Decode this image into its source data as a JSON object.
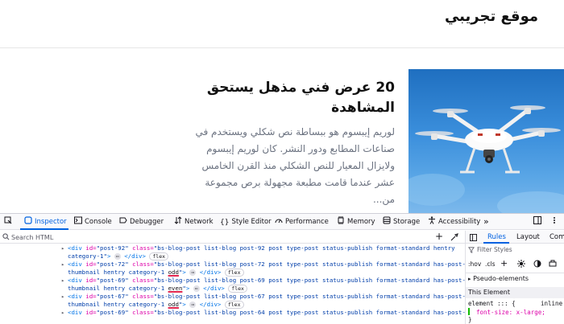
{
  "site": {
    "title": "موقع تجريبي",
    "post": {
      "title_line1": "20 عرض فني مذهل يستحق",
      "title_line2": "المشاهدة",
      "excerpt_lines": [
        "لوريم إيبسوم هو ببساطة نص شكلي ويستخدم في",
        "صناعات المطابع ودور النشر. كان لوريم إيبسوم",
        "ولايزال المعيار للنص الشكلي منذ القرن الخامس",
        "عشر عندما قامت مطبعة مجهولة برص مجموعة",
        "من..."
      ]
    }
  },
  "devtools": {
    "tabs": [
      {
        "label": "Inspector",
        "icon": "inspector-icon"
      },
      {
        "label": "Console",
        "icon": "console-icon"
      },
      {
        "label": "Debugger",
        "icon": "debugger-icon"
      },
      {
        "label": "Network",
        "icon": "network-icon"
      },
      {
        "label": "Style Editor",
        "icon": "style-editor-icon"
      },
      {
        "label": "Performance",
        "icon": "performance-icon"
      },
      {
        "label": "Memory",
        "icon": "memory-icon"
      },
      {
        "label": "Storage",
        "icon": "storage-icon"
      },
      {
        "label": "Accessibility",
        "icon": "accessibility-icon"
      }
    ],
    "more_tabs": "»",
    "search_placeholder": "Search HTML",
    "markup": {
      "row0": {
        "open": "<div ",
        "id_attr": "id=",
        "id_val": "\"post-92\"",
        "class_attr": " class=",
        "class_val": "\"bs-blog-post list-blog post-92 post type-post status-publish format-standard hentry"
      },
      "row1": {
        "cont": "category-1\"",
        "close": "</div>",
        "badge": "flex"
      },
      "row2": {
        "open": "<div ",
        "id_attr": "id=",
        "id_val": "\"post-72\"",
        "class_attr": " class=",
        "class_val": "\"bs-blog-post list-blog post-72 post type-post status-publish format-standard has-post-"
      },
      "row3": {
        "cont": "thumbnail hentry category-1 ",
        "hl": "odd",
        "tail": "\"",
        "close": "</div>",
        "badge": "flex"
      },
      "row4": {
        "open": "<div ",
        "id_attr": "id=",
        "id_val": "\"post-69\"",
        "class_attr": " class=",
        "class_val": "\"bs-blog-post list-blog post-69 post type-post status-publish format-standard has-post-"
      },
      "row5": {
        "cont": "thumbnail hentry category-1 ",
        "hl": "even",
        "tail": "\"",
        "close": "</div>",
        "badge": "flex"
      },
      "row6": {
        "open": "<div ",
        "id_attr": "id=",
        "id_val": "\"post-67\"",
        "class_attr": " class=",
        "class_val": "\"bs-blog-post list-blog post-67 post type-post status-publish format-standard has-post-"
      },
      "row7": {
        "cont": "thumbnail hentry category-1 ",
        "hl": "odd",
        "tail": "\"",
        "close": "</div>",
        "badge": "flex"
      },
      "row8": {
        "open": "<div ",
        "id_attr": "id=",
        "id_val": "\"post-69\"",
        "class_attr": " class=",
        "class_val": "\"bs-blog-post list-blog post-64 post type-post status-publish format-standard has-post-"
      }
    },
    "sidebar": {
      "tabs": [
        "Rules",
        "Layout",
        "Comp"
      ],
      "filter_placeholder": "Filter Styles",
      "hov": ":hov",
      "cls": ".cls",
      "pseudo_elements": "Pseudo-elements",
      "this_element": "This Element",
      "rule_selector": "element ::: {",
      "rule_source": "inline",
      "rule_prop": "font-size: x-large;",
      "rule_close": "}"
    }
  }
}
